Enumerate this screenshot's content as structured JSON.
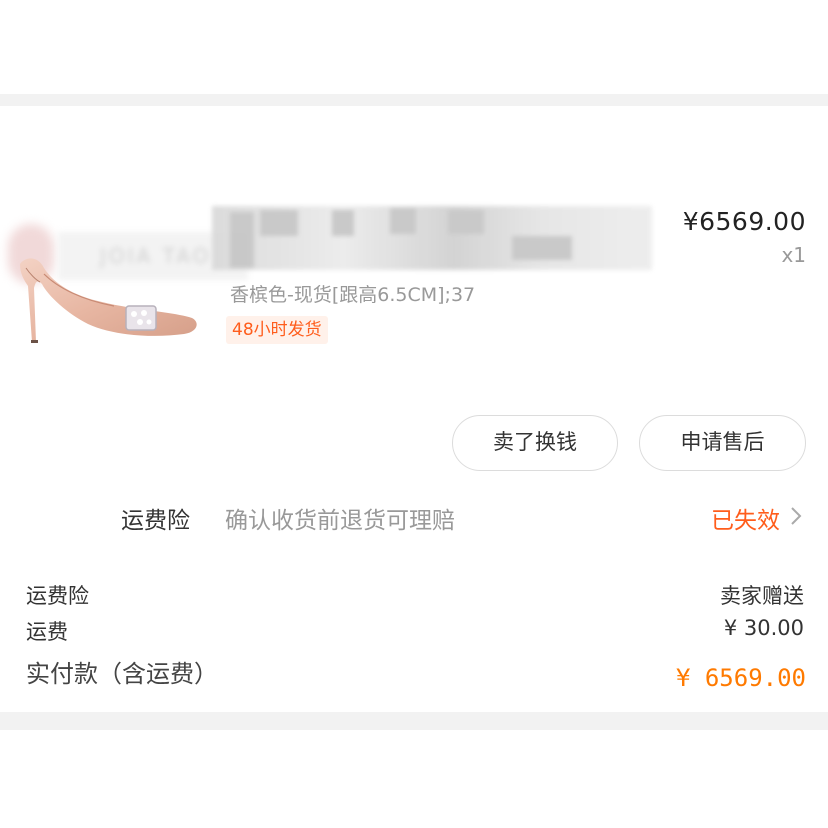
{
  "shop": {
    "name": "JOIA TAO"
  },
  "product": {
    "price": "¥6569.00",
    "quantity": "x1",
    "spec": "香槟色-现货[跟高6.5CM];37",
    "shipping_tag": "48小时发货"
  },
  "actions": {
    "sell_label": "卖了换钱",
    "after_sales_label": "申请售后"
  },
  "insurance": {
    "title": "运费险",
    "description": "确认收货前退货可理赔",
    "status": "已失效"
  },
  "summary": {
    "insurance_label": "运费险",
    "insurance_value": "卖家赠送",
    "shipping_label": "运费",
    "shipping_value": "¥ 30.00",
    "total_label": "实付款（含运费）",
    "total_value": "¥  6569.00"
  },
  "colors": {
    "accent": "#ff5d1c",
    "total": "#ff7a00",
    "text": "#333333",
    "muted": "#999999",
    "divider": "#f2f2f2"
  }
}
